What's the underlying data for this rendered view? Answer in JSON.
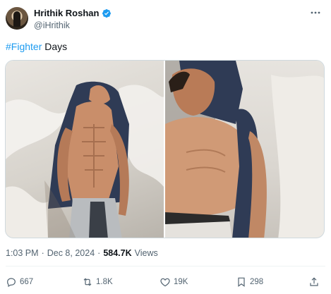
{
  "author": {
    "name": "Hrithik Roshan",
    "handle": "@iHrithik",
    "verified": true,
    "verified_color": "#1d9bf0"
  },
  "tweet": {
    "hashtag": "#Fighter",
    "text_after": " Days"
  },
  "media": {
    "photo_count": 2
  },
  "meta": {
    "time": "1:03 PM",
    "separator": "·",
    "date": "Dec 8, 2024",
    "separator2": "·",
    "views_count": "584.7K",
    "views_label": "Views"
  },
  "actions": {
    "replies": "667",
    "reposts": "1.8K",
    "likes": "19K",
    "bookmarks": "298"
  },
  "colors": {
    "accent": "#1d9bf0",
    "text_primary": "#0f1419",
    "text_secondary": "#536471"
  },
  "icons": [
    "verified-badge-icon",
    "more-icon",
    "reply-icon",
    "repost-icon",
    "like-icon",
    "bookmark-icon",
    "share-icon"
  ]
}
